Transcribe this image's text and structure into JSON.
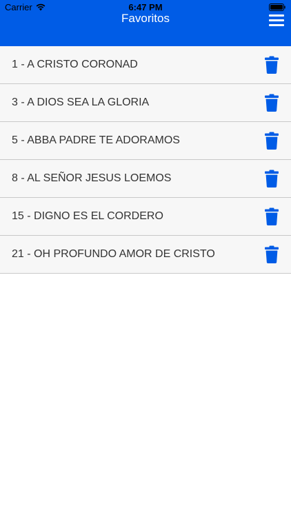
{
  "status_bar": {
    "carrier": "Carrier",
    "time": "6:47 PM",
    "wifi_icon": "wifi-icon",
    "battery_icon": "battery-icon"
  },
  "header": {
    "title": "Favoritos",
    "menu_icon": "hamburger-menu-icon",
    "background_color": "#005ce6"
  },
  "favorites": [
    {
      "label": "1 - A CRISTO CORONAD"
    },
    {
      "label": "3 - A DIOS SEA LA GLORIA"
    },
    {
      "label": "5 - ABBA PADRE TE ADORAMOS"
    },
    {
      "label": "8 - AL SEÑOR JESUS LOEMOS"
    },
    {
      "label": "15 - DIGNO ES EL CORDERO"
    },
    {
      "label": "21 - OH PROFUNDO AMOR DE CRISTO"
    }
  ],
  "row_action_icon": "trash-icon",
  "accent_color": "#005ce6"
}
